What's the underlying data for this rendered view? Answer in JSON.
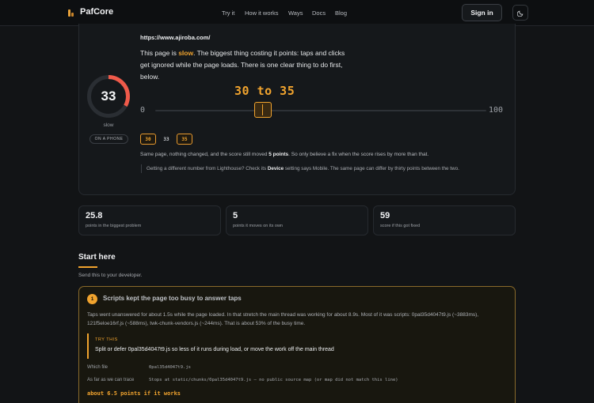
{
  "nav": {
    "brand": "PafCore",
    "links": [
      "Try it",
      "How it works",
      "Ways",
      "Docs",
      "Blog"
    ],
    "signin": "Sign in",
    "theme_icon": "moon-icon"
  },
  "score": {
    "url": "https://www.ajiroba.com/",
    "value": "33",
    "value_fraction": 0.33,
    "label": "slow",
    "device": "ON A PHONE",
    "headline_pre": "This page is ",
    "headline_slow": "slow",
    "headline_post": ". The biggest thing costing it points: taps and clicks get ignored while the page loads. There is one clear thing to do first, below.",
    "range_text": "30 to 35",
    "axis_min": "0",
    "axis_max": "100",
    "range_low": 30,
    "range_high": 35,
    "runs": [
      "30",
      "33",
      "35"
    ],
    "same_page_pre": "Same page, nothing changed, and the score still moved ",
    "same_page_bold": "5 points",
    "same_page_post": ". So only believe a fix when the score rises by more than that.",
    "lh_pre": "Getting a different number from Lighthouse? Check its ",
    "lh_bold": "Device",
    "lh_post": " setting says Mobile. The same page can differ by thirty points between the two.",
    "colors": {
      "gauge": "#ef5a4a",
      "accent": "#f0a32e"
    }
  },
  "stats": [
    {
      "value": "25.8",
      "label": "points in the biggest problem"
    },
    {
      "value": "5",
      "label": "points it moves on its own"
    },
    {
      "value": "59",
      "label": "score if this got fixed"
    }
  ],
  "start": {
    "title": "Start here",
    "subtitle": "Send this to your developer.",
    "issue": {
      "number": "1",
      "title": "Scripts kept the page too busy to answer taps",
      "body": "Taps went unanswered for about 1.5s while the page loaded. In that stretch the main thread was working for about 8.9s. Most of it was scripts: 0pal35d4047t9.js (~3883ms), 121f5eloe16rf.js (~588ms), twk-chunk-vendors.js (~244ms). That is about 53% of the busy time.",
      "try_label": "TRY THIS",
      "try_text": "Split or defer 0pal35d4047t9.js so less of it runs during load, or move the work off the main thread",
      "which_file_key": "Which file",
      "which_file_val": "0pal35d4047t9.js",
      "trace_key": "As far as we can trace",
      "trace_val": "Stops at static/chunks/0pal35d4047t9.js — no public source map (or map did not match this line)",
      "gain": "about 6.5 points if it works"
    }
  }
}
